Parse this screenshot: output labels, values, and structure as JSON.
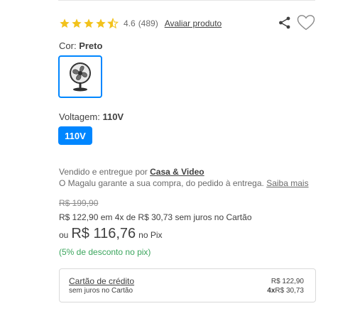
{
  "rating": {
    "value": "4.6",
    "count": "(489)",
    "stars_filled": 4.5,
    "stars_total": 5,
    "star_color": "#f2c21c",
    "review_link": "Avaliar produto"
  },
  "actions": {
    "share_icon": "share-icon",
    "favorite_icon": "heart-icon"
  },
  "color": {
    "label": "Cor:",
    "selected": "Preto",
    "swatch_icon": "fan-image"
  },
  "voltage": {
    "label": "Voltagem:",
    "selected": "110V",
    "options": [
      "110V"
    ],
    "accent": "#0086ff"
  },
  "seller": {
    "prefix": "Vendido e entregue por",
    "name": "Casa & Video",
    "guarantee": "O Magalu garante a sua compra, do pedido à entrega.",
    "guarantee_link": "Saiba mais"
  },
  "price": {
    "old": "R$ 199,90",
    "installments": "R$ 122,90 em 4x de R$ 30,73 sem juros no Cartão",
    "pix_prefix": "ou",
    "pix_price": "R$ 116,76",
    "pix_suffix": "no Pix",
    "discount": "(5% de desconto no pix)",
    "discount_color": "#3ba55d"
  },
  "card_option": {
    "title": "Cartão de crédito",
    "subtitle": "sem juros no Cartão",
    "total": "R$ 122,90",
    "installment_count": "4x",
    "installment_value": "R$ 30,73"
  }
}
